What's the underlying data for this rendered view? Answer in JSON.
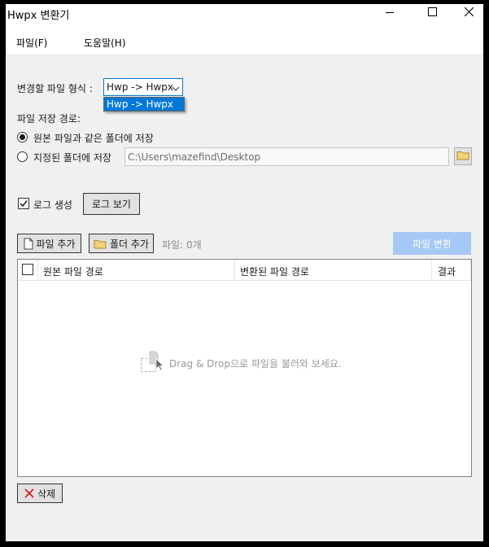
{
  "window": {
    "title": "Hwpx 변환기"
  },
  "menu": {
    "file": "파일(F)",
    "help": "도움말(H)"
  },
  "format": {
    "label": "변경할 파일 형식 :",
    "selected": "Hwp -> Hwpx",
    "options": [
      "Hwp -> Hwpx"
    ]
  },
  "save_path": {
    "label": "파일 저장 경로:",
    "option_same": "원본 파일과 같은 폴더에 저장",
    "option_custom": "지정된 폴더에 저장",
    "selected": "option_same",
    "path_value": "C:\\Users\\mazefind\\Desktop"
  },
  "log": {
    "checkbox_label": "로그 생성",
    "checked": true,
    "view_button": "로그 보기"
  },
  "toolbar": {
    "add_file": "파일 추가",
    "add_folder": "폴더 추가",
    "file_count": "파일: 0개",
    "convert": "파일 변환"
  },
  "list": {
    "columns": [
      "원본 파일 경로",
      "변환된 파일 경로",
      "결과"
    ],
    "rows": [],
    "empty_hint": "Drag & Drop으로 파일을 불러와 보세요."
  },
  "delete_button": "삭제",
  "icons": {
    "minimize": "minimize-icon",
    "maximize": "maximize-icon",
    "close": "close-icon",
    "folder": "folder-icon",
    "file": "file-icon",
    "delete": "red-x-icon"
  },
  "colors": {
    "accent": "#0078d7",
    "convert_disabled": "#a6c8f5",
    "delete_red": "#d42020"
  }
}
